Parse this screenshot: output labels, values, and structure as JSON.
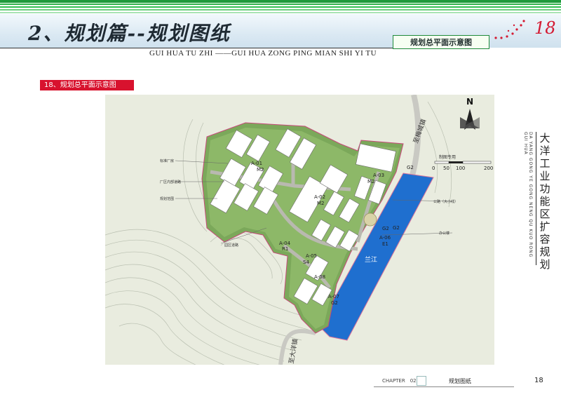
{
  "header": {
    "title": "2、规划篇--规划图纸",
    "subtitle": "GUI HUA TU ZHI ——GUI HUA ZONG PING MIAN SHI YI TU",
    "box_label": "规划总平面示意图",
    "page_badge": "18"
  },
  "section_tag": "18、规划总平面示意图",
  "plan": {
    "north": "N",
    "road_label": "至梅城镇",
    "road_label_south": "至大洋镇",
    "river": "兰江",
    "scale_label": "制图专用",
    "scale_ticks": [
      "0",
      "50",
      "100",
      "200"
    ],
    "legend_left": [
      "标准厂房",
      "厂区内部道路",
      "规划范围",
      "园区道路"
    ],
    "legend_right": [
      "公路（大小线）",
      "办公楼"
    ],
    "plots": [
      {
        "code": "A-01",
        "sub": "M2"
      },
      {
        "code": "A-02",
        "sub": "M2"
      },
      {
        "code": "A-03",
        "sub": "M2"
      },
      {
        "code": "A-04",
        "sub": "R1"
      },
      {
        "code": "A-05",
        "sub": "S4"
      },
      {
        "code": "A-06",
        "sub": "E1"
      },
      {
        "code": "A-07",
        "sub": "G2"
      },
      {
        "code": "A-08",
        "sub": "M2"
      }
    ],
    "side_codes": [
      "G2",
      "G2",
      "G2"
    ]
  },
  "side": {
    "title_cn": "大洋工业功能区扩容规划",
    "title_en": "DA YANG GONG YE GONG NENG QU KUO RONG GUI HUA"
  },
  "footer": {
    "chapter": "CHAPTER　02",
    "label": "规划图纸",
    "page": "18"
  }
}
